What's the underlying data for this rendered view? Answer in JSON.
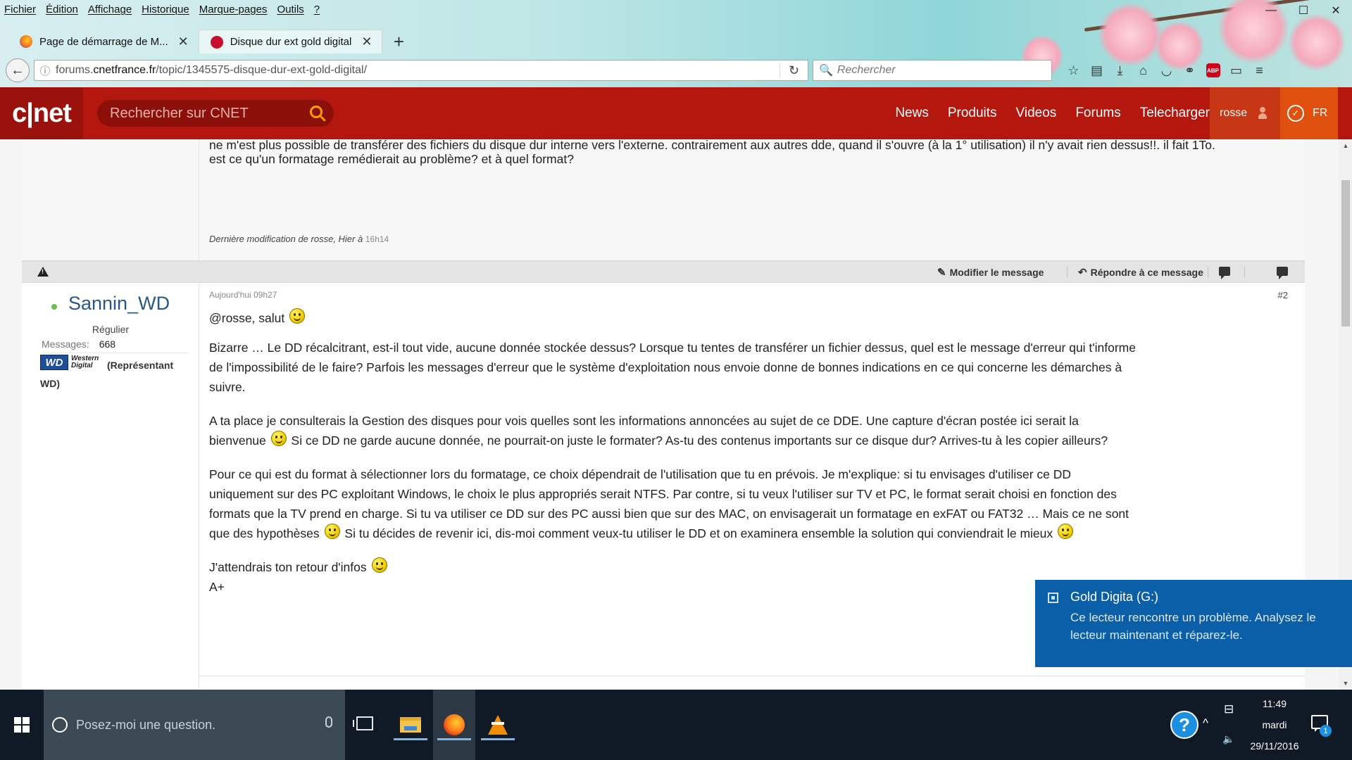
{
  "browser": {
    "menu": [
      "Fichier",
      "Édition",
      "Affichage",
      "Historique",
      "Marque-pages",
      "Outils",
      "?"
    ],
    "window_controls": {
      "minimize": "—",
      "maximize": "☐",
      "close": "✕"
    },
    "tabs": [
      {
        "title": "Page de démarrage de M...",
        "icon": "firefox-icon",
        "active": false
      },
      {
        "title": "Disque dur ext gold digital",
        "icon": "cnet-icon",
        "active": true
      }
    ],
    "new_tab": "+",
    "url_prefix": "forums.",
    "url_domain": "cnetfrance.fr",
    "url_path": "/topic/1345575-disque-dur-ext-gold-digital/",
    "search_placeholder": "Rechercher",
    "toolbar_icons": [
      "star-icon",
      "reading-list-icon",
      "download-icon",
      "home-icon",
      "pocket-icon",
      "share-icon",
      "adblock-icon",
      "screenshot-icon",
      "menu-icon"
    ],
    "abp_label": "ABP"
  },
  "cnet": {
    "logo": "c|net",
    "search_placeholder": "Rechercher sur CNET",
    "nav": [
      "News",
      "Produits",
      "Videos",
      "Forums",
      "Telecharger"
    ],
    "user": "rosse",
    "lang": "FR",
    "brand_color": "#b3170e"
  },
  "post1": {
    "cut_line": "ne m'est plus possible de transférer des fichiers du disque dur interne vers l'externe. contrairement aux autres dde, quand il s'ouvre (à la 1° utilisation) il n'y avait rien dessus!!. il fait 1To.",
    "line2": "est ce qu'un formatage remédierait au problème? et à quel format?",
    "last_modified": "Dernière modification de rosse, Hier à",
    "last_modified_time": "16h14"
  },
  "actions": {
    "edit": "Modifier le message",
    "reply": "Répondre à ce message"
  },
  "post2": {
    "author": "Sannin_WD",
    "role": "Régulier",
    "messages_label": "Messages:",
    "messages_count": "668",
    "wd_logo": "WD",
    "wd_text_1": "Western",
    "wd_text_2": "Digital",
    "rep_label": "(Représentant WD)",
    "date": "Aujourd'hui 09h27",
    "number": "#2",
    "greeting": "@rosse, salut",
    "p1": "Bizarre … Le DD récalcitrant, est-il tout vide, aucune donnée stockée dessus? Lorsque tu tentes de transférer un fichier dessus, quel est le message d'erreur qui t'informe de l'impossibilité de le faire? Parfois les messages d'erreur que le système d'exploitation nous envoie donne de bonnes indications en ce qui concerne les démarches à suivre.",
    "p2a": "A ta place je consulterais la Gestion des disques pour vois quelles sont les informations annoncées au sujet de ce DDE. Une capture d'écran postée ici serait la bienvenue",
    "p2b": "Si ce DD ne garde aucune donnée, ne pourrait-on juste le formater? As-tu des contenus importants sur ce disque dur? Arrives-tu à les copier ailleurs?",
    "p3a": "Pour ce qui est du format à sélectionner lors du formatage, ce choix dépendrait de l'utilisation que tu en prévois. Je m'explique: si tu envisages d'utiliser ce DD uniquement sur des PC exploitant Windows, le choix le plus appropriés serait NTFS. Par contre, si tu veux l'utiliser sur TV et PC, le format serait choisi en fonction des formats que la TV prend en charge. Si tu va utiliser ce DD sur des PC aussi bien que sur des MAC, on envisagerait un formatage en exFAT ou FAT32 … Mais ce ne sont que des hypothèses",
    "p3b": "Si tu décides de revenir ici, dis-moi comment veux-tu utiliser le DD et on examinera ensemble la solution qui conviendrait le mieux",
    "p4": "J'attendrais ton retour d'infos",
    "signoff": "A+"
  },
  "toast": {
    "title": "Gold Digita (G:)",
    "body": "Ce lecteur rencontre un problème. Analysez le lecteur maintenant et réparez-le."
  },
  "taskbar": {
    "cortana_placeholder": "Posez-moi une question.",
    "apps": [
      "file-explorer-icon",
      "firefox-icon",
      "vlc-icon"
    ],
    "help": "?",
    "tray_chevron": "^",
    "network": "⊟",
    "volume": "🔈",
    "time": "11:49",
    "day": "mardi",
    "date": "29/11/2016",
    "notifications": "1"
  }
}
